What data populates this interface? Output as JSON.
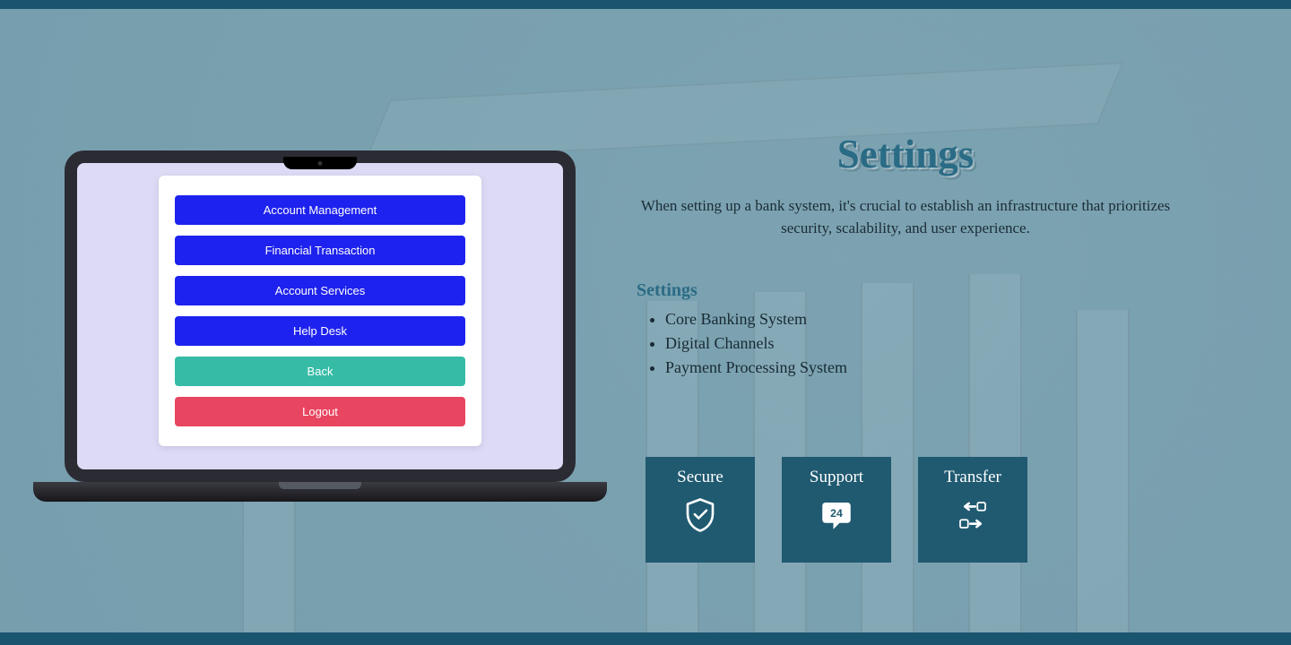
{
  "laptop": {
    "menu": [
      {
        "label": "Account Management",
        "style": "primary"
      },
      {
        "label": "Financial Transaction",
        "style": "primary"
      },
      {
        "label": "Account Services",
        "style": "primary"
      },
      {
        "label": "Help Desk",
        "style": "primary"
      },
      {
        "label": "Back",
        "style": "teal"
      },
      {
        "label": "Logout",
        "style": "red"
      }
    ]
  },
  "right": {
    "heading": "Settings",
    "description": "When setting up a bank system, it's crucial to establish an infrastructure that prioritizes security, scalability, and user experience.",
    "section_title": "Settings",
    "bullets": [
      "Core Banking System",
      "Digital Channels",
      "Payment Processing System"
    ]
  },
  "cards": [
    {
      "title": "Secure",
      "icon": "shield-check-icon"
    },
    {
      "title": "Support",
      "icon": "support-24-icon"
    },
    {
      "title": "Transfer",
      "icon": "transfer-icon"
    }
  ]
}
